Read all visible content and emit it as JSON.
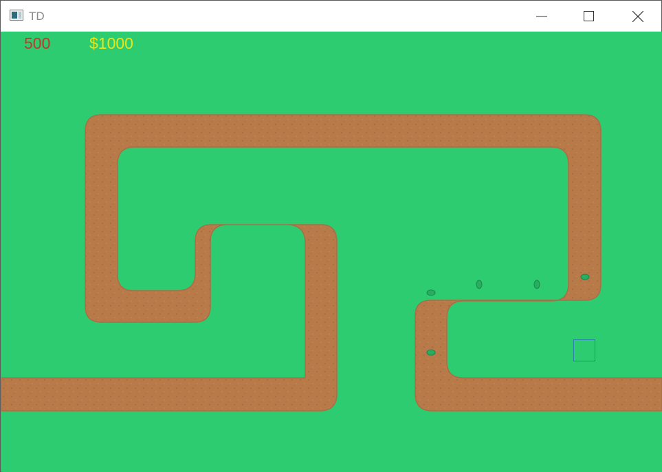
{
  "window": {
    "title": "TD",
    "icon": "app-icon",
    "controls": [
      "minimize-icon",
      "maximize-icon",
      "close-icon"
    ]
  },
  "hud": {
    "lives": "500",
    "money": "$1000",
    "lives_color": "#c0392b",
    "money_color": "#e6e619"
  },
  "colors": {
    "grass": "#2ecc71",
    "path": "#b97a4a",
    "path_edge": "#a86e45",
    "enemy": "#27ae60",
    "placement_cursor": "#2b7bb5"
  },
  "enemies": [
    "enemy",
    "enemy",
    "enemy",
    "enemy",
    "enemy"
  ],
  "placement_cursor": "tower-placement-cursor"
}
